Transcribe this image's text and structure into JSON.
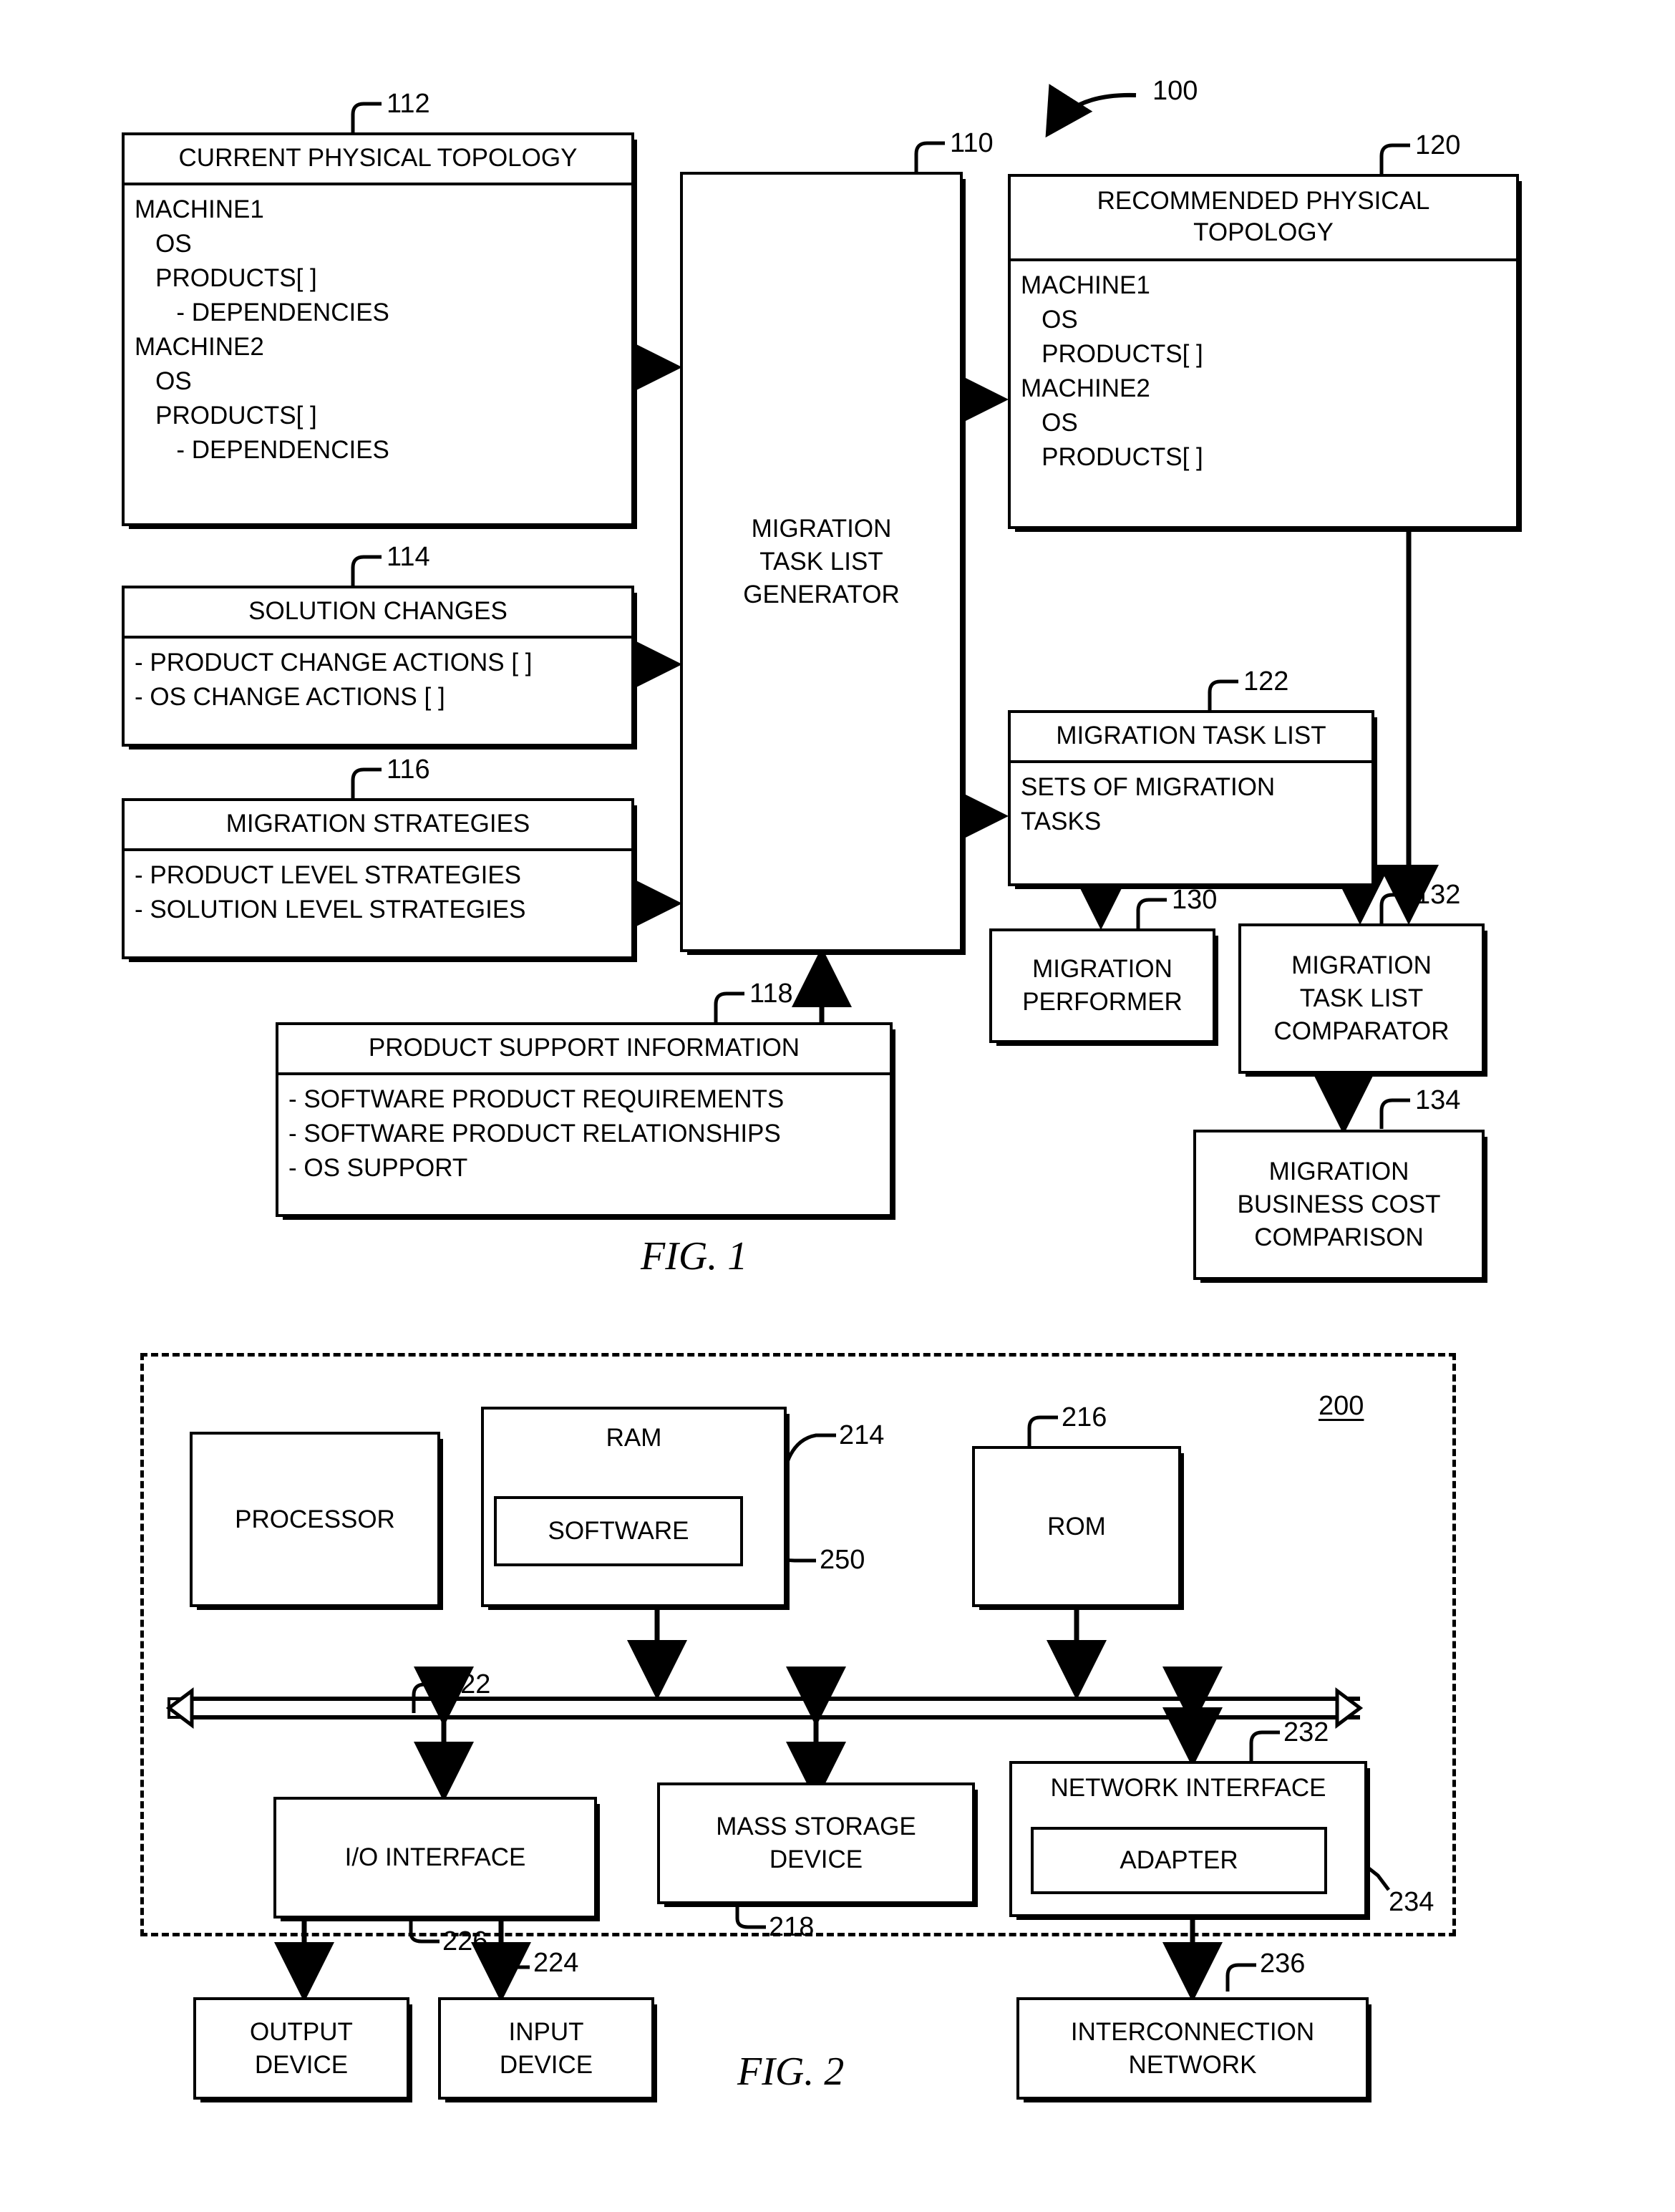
{
  "figure1": {
    "caption": "FIG. 1",
    "system_ref": "100",
    "blocks": {
      "current_topology": {
        "ref": "112",
        "title": "CURRENT PHYSICAL TOPOLOGY",
        "lines": [
          "MACHINE1",
          "   OS",
          "   PRODUCTS[ ]",
          "      - DEPENDENCIES",
          "MACHINE2",
          "   OS",
          "   PRODUCTS[ ]",
          "      - DEPENDENCIES"
        ]
      },
      "solution_changes": {
        "ref": "114",
        "title": "SOLUTION CHANGES",
        "lines": [
          "- PRODUCT CHANGE ACTIONS [ ]",
          "- OS CHANGE ACTIONS [ ]"
        ]
      },
      "migration_strategies": {
        "ref": "116",
        "title": "MIGRATION STRATEGIES",
        "lines": [
          "- PRODUCT LEVEL STRATEGIES",
          "- SOLUTION LEVEL STRATEGIES"
        ]
      },
      "product_support_information": {
        "ref": "118",
        "title": "PRODUCT SUPPORT INFORMATION",
        "lines": [
          "- SOFTWARE PRODUCT REQUIREMENTS",
          "- SOFTWARE PRODUCT RELATIONSHIPS",
          "- OS SUPPORT"
        ]
      },
      "task_list_generator": {
        "ref": "110",
        "label": "MIGRATION\nTASK LIST\nGENERATOR"
      },
      "recommended_topology": {
        "ref": "120",
        "title": "RECOMMENDED PHYSICAL TOPOLOGY",
        "lines": [
          "MACHINE1",
          "   OS",
          "   PRODUCTS[ ]",
          "MACHINE2",
          "   OS",
          "   PRODUCTS[ ]"
        ]
      },
      "migration_task_list": {
        "ref": "122",
        "title": "MIGRATION TASK LIST",
        "lines": [
          "SETS OF MIGRATION",
          "TASKS"
        ]
      },
      "migration_performer": {
        "ref": "130",
        "label": "MIGRATION\nPERFORMER"
      },
      "task_list_comparator": {
        "ref": "132",
        "label": "MIGRATION\nTASK LIST\nCOMPARATOR"
      },
      "business_cost_comparison": {
        "ref": "134",
        "label": "MIGRATION\nBUSINESS COST\nCOMPARISON"
      }
    }
  },
  "figure2": {
    "caption": "FIG. 2",
    "system_ref": "200",
    "blocks": {
      "processor": {
        "label": "PROCESSOR"
      },
      "ram": {
        "ref": "214",
        "label": "RAM"
      },
      "software": {
        "ref": "250",
        "label": "SOFTWARE"
      },
      "rom": {
        "ref": "216",
        "label": "ROM"
      },
      "bus": {
        "ref": "222"
      },
      "io_interface": {
        "ref": "226",
        "label": "I/O INTERFACE"
      },
      "mass_storage_device": {
        "ref": "218",
        "label": "MASS STORAGE\nDEVICE"
      },
      "network_interface": {
        "ref": "232",
        "label": "NETWORK INTERFACE"
      },
      "adapter": {
        "ref": "234",
        "label": "ADAPTER"
      },
      "output_device": {
        "label": "OUTPUT\nDEVICE"
      },
      "input_device": {
        "ref": "224",
        "label": "INPUT\nDEVICE"
      },
      "interconnection_network": {
        "ref": "236",
        "label": "INTERCONNECTION\nNETWORK"
      }
    }
  }
}
